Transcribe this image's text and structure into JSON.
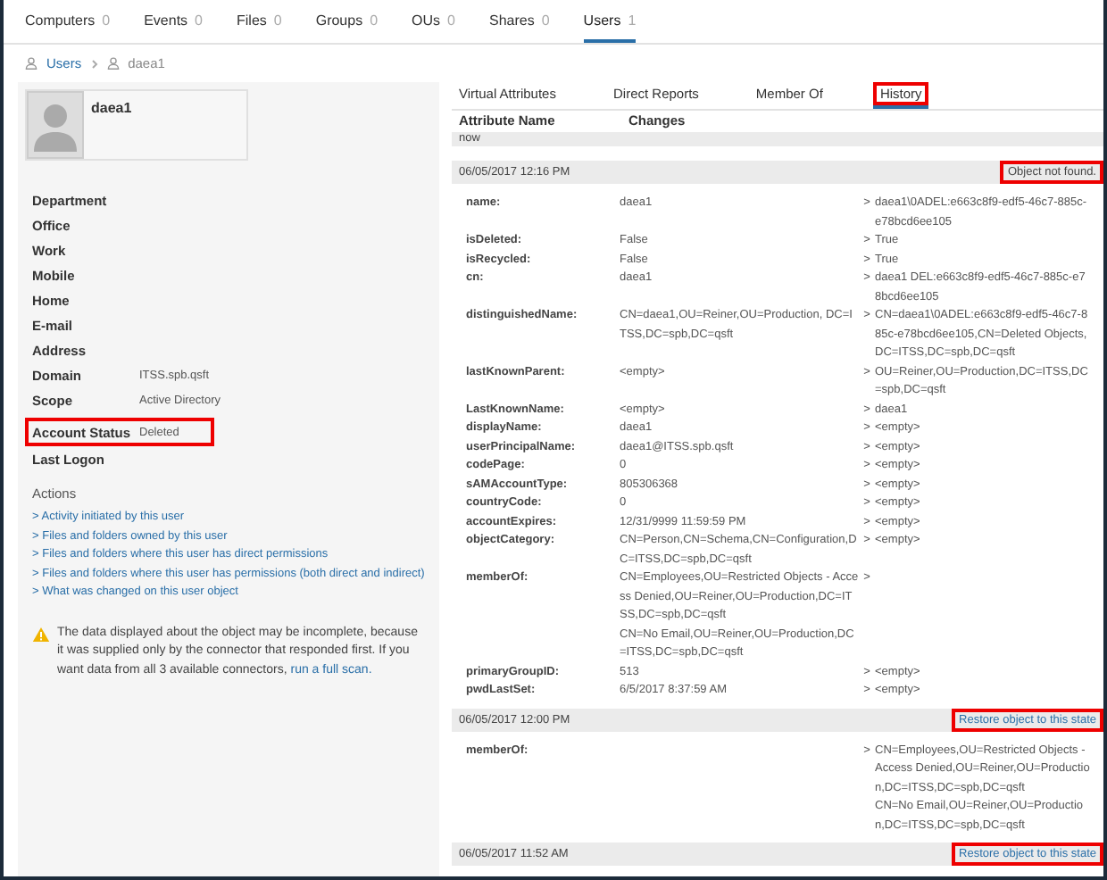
{
  "top_tabs": [
    {
      "label": "Computers",
      "count": "0",
      "selected": false
    },
    {
      "label": "Events",
      "count": "0",
      "selected": false
    },
    {
      "label": "Files",
      "count": "0",
      "selected": false
    },
    {
      "label": "Groups",
      "count": "0",
      "selected": false
    },
    {
      "label": "OUs",
      "count": "0",
      "selected": false
    },
    {
      "label": "Shares",
      "count": "0",
      "selected": false
    },
    {
      "label": "Users",
      "count": "1",
      "selected": true
    }
  ],
  "breadcrumb": [
    {
      "label": "Users",
      "kind": "link"
    },
    {
      "label": "daea1",
      "kind": "current"
    }
  ],
  "profile": {
    "name": "daea1"
  },
  "properties": [
    {
      "label": "Department",
      "highlighted": false
    },
    {
      "label": "Office",
      "highlighted": false
    },
    {
      "label": "Work",
      "highlighted": false
    },
    {
      "label": "Mobile",
      "highlighted": false
    },
    {
      "label": "Home",
      "highlighted": false
    },
    {
      "label": "E-mail",
      "highlighted": false
    },
    {
      "label": "Address",
      "highlighted": false
    },
    {
      "label": "Domain",
      "value": "ITSS.spb.qsft",
      "highlighted": false
    },
    {
      "label": "Scope",
      "value": "Active Directory",
      "highlighted": false
    },
    {
      "label": "Account Status",
      "value": "Deleted",
      "highlighted": true
    },
    {
      "label": "Last Logon",
      "highlighted": false
    }
  ],
  "actions": {
    "title": "Actions",
    "links": [
      "> Activity initiated by this user",
      "> Files and folders owned by this user",
      "> Files and folders where this user has direct permissions",
      "> Files and folders where this user has permissions (both direct and indirect)",
      "> What was changed on this user object"
    ]
  },
  "notice": {
    "text": "The data displayed about the object may be incomplete, because it was supplied only by the connector that responded first. If you want data from all 3 available connectors, ",
    "link": "run a full scan."
  },
  "detail_tabs": [
    {
      "label": "Virtual Attributes",
      "selected": false,
      "highlighted": false
    },
    {
      "label": "Direct Reports",
      "selected": false,
      "highlighted": false
    },
    {
      "label": "Member Of",
      "selected": false,
      "highlighted": false
    },
    {
      "label": "History",
      "selected": true,
      "highlighted": true
    }
  ],
  "history": {
    "columns": [
      "Attribute Name",
      "Changes"
    ],
    "current_label": "now",
    "entries": [
      {
        "timestamp": "06/05/2017 12:16 PM",
        "status": {
          "text": "Object not found.",
          "kind": "message",
          "highlighted": true
        },
        "changes": [
          {
            "attribute": "name:",
            "old": "daea1",
            "arrow": ">",
            "new": "daea1\\0ADEL:e663c8f9-edf5-46c7-885c-e78bcd6ee105"
          },
          {
            "attribute": "isDeleted:",
            "old": "False",
            "arrow": ">",
            "new": "True"
          },
          {
            "attribute": "isRecycled:",
            "old": "False",
            "arrow": ">",
            "new": "True"
          },
          {
            "attribute": "cn:",
            "old": "daea1",
            "arrow": ">",
            "new": "daea1 DEL:e663c8f9-edf5-46c7-885c-e78bcd6ee105"
          },
          {
            "attribute": "distinguishedName:",
            "old": "CN=daea1,OU=Reiner,OU=Production, DC=ITSS,DC=spb,DC=qsft",
            "arrow": ">",
            "new": "CN=daea1\\0ADEL:e663c8f9-edf5-46c7-885c-e78bcd6ee105,CN=Deleted Objects,DC=ITSS,DC=spb,DC=qsft"
          },
          {
            "attribute": "lastKnownParent:",
            "old": "<empty>",
            "arrow": ">",
            "new": "OU=Reiner,OU=Production,DC=ITSS,DC=spb,DC=qsft"
          },
          {
            "attribute": "LastKnownName:",
            "old": "<empty>",
            "arrow": ">",
            "new": "daea1"
          },
          {
            "attribute": "displayName:",
            "old": "daea1",
            "arrow": ">",
            "new": "<empty>"
          },
          {
            "attribute": "userPrincipalName:",
            "old": "daea1@ITSS.spb.qsft",
            "arrow": ">",
            "new": "<empty>"
          },
          {
            "attribute": "codePage:",
            "old": "0",
            "arrow": ">",
            "new": "<empty>"
          },
          {
            "attribute": "sAMAccountType:",
            "old": "805306368",
            "arrow": ">",
            "new": "<empty>"
          },
          {
            "attribute": "countryCode:",
            "old": "0",
            "arrow": ">",
            "new": "<empty>"
          },
          {
            "attribute": "accountExpires:",
            "old": "12/31/9999 11:59:59 PM",
            "arrow": ">",
            "new": "<empty>"
          },
          {
            "attribute": "objectCategory:",
            "old": "CN=Person,CN=Schema,CN=Configuration,DC=ITSS,DC=spb,DC=qsft",
            "arrow": ">",
            "new": "<empty>"
          },
          {
            "attribute": "memberOf:",
            "old": "CN=Employees,OU=Restricted Objects - Access Denied,OU=Reiner,OU=Production,DC=ITSS,DC=spb,DC=qsft\nCN=No Email,OU=Reiner,OU=Production,DC=ITSS,DC=spb,DC=qsft",
            "arrow": ">"
          },
          {
            "attribute": "primaryGroupID:",
            "old": "513",
            "arrow": ">",
            "new": "<empty>"
          },
          {
            "attribute": "pwdLastSet:",
            "old": "6/5/2017 8:37:59 AM",
            "arrow": ">",
            "new": "<empty>"
          }
        ]
      },
      {
        "timestamp": "06/05/2017 12:00 PM",
        "status": {
          "text": "Restore object to this state",
          "kind": "link",
          "highlighted": true
        },
        "changes": [
          {
            "attribute": "memberOf:",
            "arrow": ">",
            "new": "CN=Employees,OU=Restricted Objects - Access Denied,OU=Reiner,OU=Production,DC=ITSS,DC=spb,DC=qsft\nCN=No Email,OU=Reiner,OU=Production,DC=ITSS,DC=spb,DC=qsft"
          }
        ]
      },
      {
        "timestamp": "06/05/2017 11:52 AM",
        "status": {
          "text": "Restore object to this state",
          "kind": "link",
          "highlighted": true
        }
      }
    ]
  }
}
